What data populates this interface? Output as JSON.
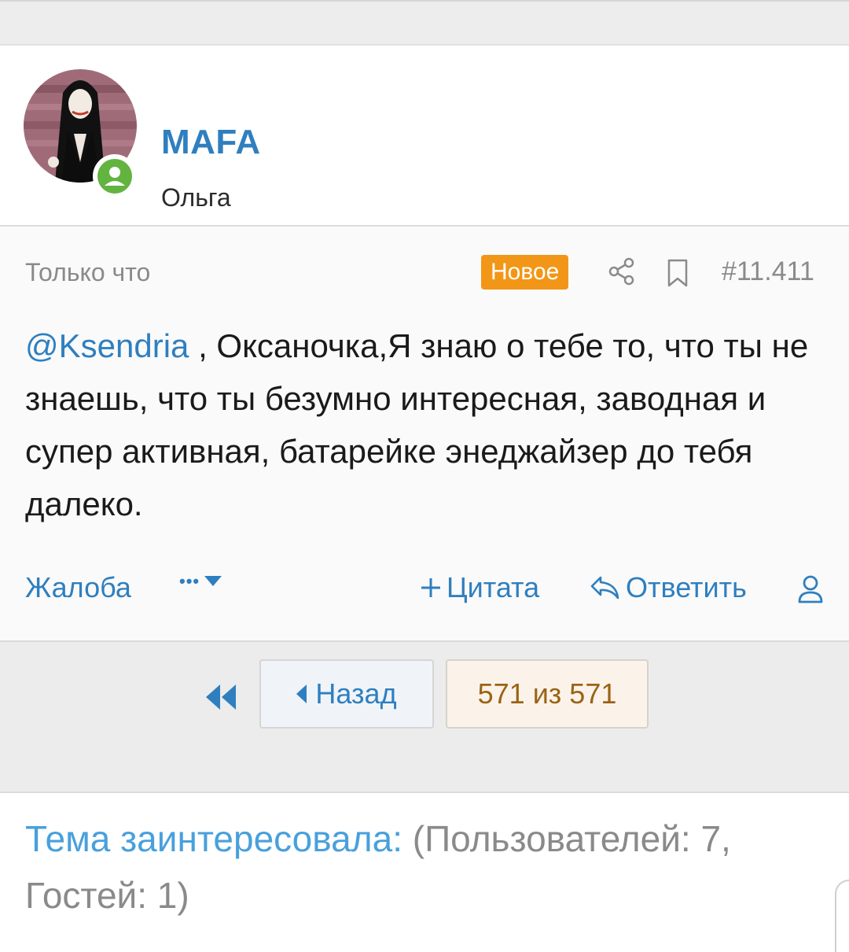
{
  "user": {
    "name": "MAFA",
    "title": "Ольга",
    "online_icon": "user-online-icon"
  },
  "post": {
    "time": "Только что",
    "badge": "Новое",
    "number": "#11.411",
    "mention": "@Ksendria",
    "body": " , Оксаночка,Я знаю о тебе то, что ты не знаешь, что ты безумно интересная, заводная и супер активная, батарейке энеджайзер до тебя далеко.",
    "actions": {
      "report": "Жалоба",
      "more": "•••",
      "quote": "Цитата",
      "reply": "Ответить"
    }
  },
  "pagination": {
    "prev": "Назад",
    "current": "571 из 571"
  },
  "viewers": {
    "label": "Тема заинтересовала:",
    "counts": "(Пользователей: 7, Гостей: 1)"
  },
  "colors": {
    "link": "#2f7fbf",
    "badge": "#f29617",
    "online": "#63b341",
    "muted": "#8a8a8a"
  }
}
